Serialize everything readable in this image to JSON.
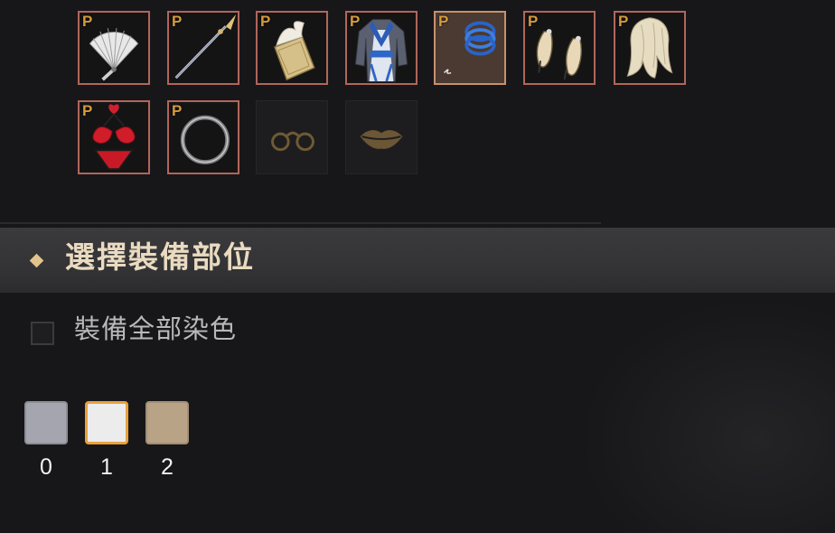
{
  "equipment_slots": [
    {
      "name": "fan",
      "badge": "P"
    },
    {
      "name": "spear",
      "badge": "P"
    },
    {
      "name": "book",
      "badge": "P"
    },
    {
      "name": "outfit",
      "badge": "P"
    },
    {
      "name": "bracelet",
      "badge": "P",
      "selected": true
    },
    {
      "name": "shoes",
      "badge": "P"
    },
    {
      "name": "hair",
      "badge": "P"
    },
    {
      "name": "underwear",
      "badge": "P"
    },
    {
      "name": "ring",
      "badge": "P"
    },
    {
      "name": "glasses",
      "badge": ""
    },
    {
      "name": "lips",
      "badge": ""
    }
  ],
  "section": {
    "title": "選擇裝備部位"
  },
  "dye_all": {
    "label": "裝備全部染色",
    "checked": false
  },
  "palette": [
    {
      "label": "0",
      "color": "#a4a5ae"
    },
    {
      "label": "1",
      "color": "#ececec",
      "selected": true
    },
    {
      "label": "2",
      "color": "#b9a386"
    }
  ],
  "colors": {
    "slot_border": "#b0665a",
    "badge": "#d69a3c",
    "swatch_selected_border": "#e7a13d"
  }
}
